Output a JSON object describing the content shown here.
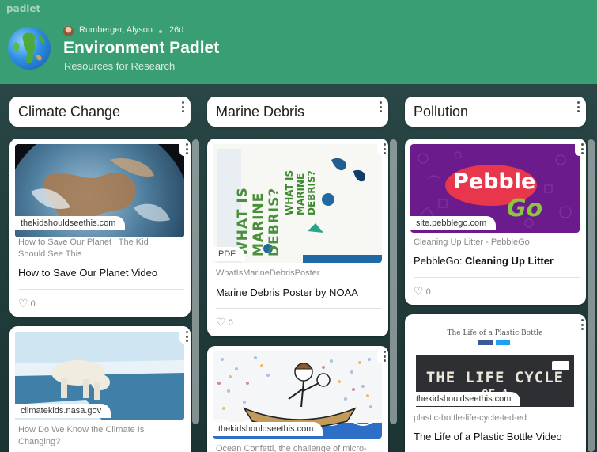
{
  "app": {
    "brand": "padlet"
  },
  "header": {
    "author": "Rumberger, Alyson",
    "age": "26d",
    "title": "Environment Padlet",
    "subtitle": "Resources for Research"
  },
  "columns": [
    {
      "title": "Climate Change",
      "cards": [
        {
          "source": "thekidshouldseethis.com",
          "meta": "How to Save Our Planet | The Kid Should See This",
          "title": "How to Save Our Planet Video",
          "likes": "0"
        },
        {
          "source": "climatekids.nasa.gov",
          "meta": "How Do We Know the Climate Is Changing?"
        }
      ]
    },
    {
      "title": "Marine Debris",
      "cards": [
        {
          "badge": "PDF",
          "meta": "WhatIsMarineDebrisPoster",
          "title": "Marine Debris Poster by NOAA",
          "likes": "0",
          "poster_text_a": "WHAT IS MARINE DEBRIS?",
          "poster_text_b": "WHAT IS MARINE DEBRIS?"
        },
        {
          "source": "thekidshouldseethis.com",
          "meta": "Ocean Confetti, the challenge of micro-"
        }
      ]
    },
    {
      "title": "Pollution",
      "cards": [
        {
          "source": "site.pebblego.com",
          "meta": "Cleaning Up Litter - PebbleGo",
          "title_prefix": "PebbleGo: ",
          "title_main": "Cleaning Up Litter",
          "likes": "0",
          "logo_a": "Pebble",
          "logo_b": "Go"
        },
        {
          "source": "thekidshouldseethis.com",
          "meta": "plastic-bottle-life-cycle-ted-ed",
          "title": "The Life of a Plastic Bottle Video",
          "video_title": "The Life of a Plastic Bottle",
          "video_caption": "THE LIFE CYCLE",
          "video_subcaption": "OF A"
        }
      ]
    }
  ],
  "colors": {
    "header_bg": "#3a9e74",
    "pebble_purple": "#6b1b8c",
    "pebble_red": "#e8364c",
    "pebble_green": "#8cc63f"
  }
}
